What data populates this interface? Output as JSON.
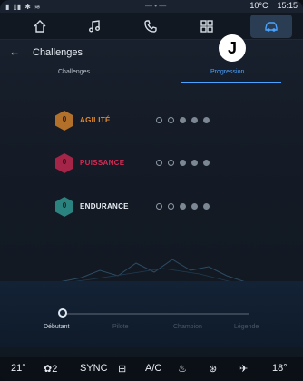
{
  "status": {
    "temp": "10°C",
    "time": "15:15"
  },
  "tabs": [
    {
      "name": "home-icon"
    },
    {
      "name": "music-icon"
    },
    {
      "name": "phone-icon"
    },
    {
      "name": "apps-icon"
    },
    {
      "name": "car-icon",
      "active": true
    }
  ],
  "header": {
    "title": "Challenges",
    "badge": "J"
  },
  "subtabs": {
    "left": "Challenges",
    "right": "Progression"
  },
  "challenges": [
    {
      "label": "AGILITÉ",
      "level": "0",
      "color": "#e58a2a",
      "hex_color": "#c47a2a"
    },
    {
      "label": "PUISSANCE",
      "level": "0",
      "color": "#d62a54",
      "hex_color": "#b4274c"
    },
    {
      "label": "ENDURANCE",
      "level": "0",
      "color": "#e8edf3",
      "hex_color": "#2f8f8a"
    }
  ],
  "progression": {
    "levels": [
      "Débutant",
      "Pilote",
      "Champion",
      "Légende"
    ],
    "current": "Débutant"
  },
  "climate": {
    "left_temp": "21°",
    "fan": "2",
    "sync": "SYNC",
    "ac": "A/C",
    "right_temp": "18°"
  },
  "accent": "#4aa3ff"
}
